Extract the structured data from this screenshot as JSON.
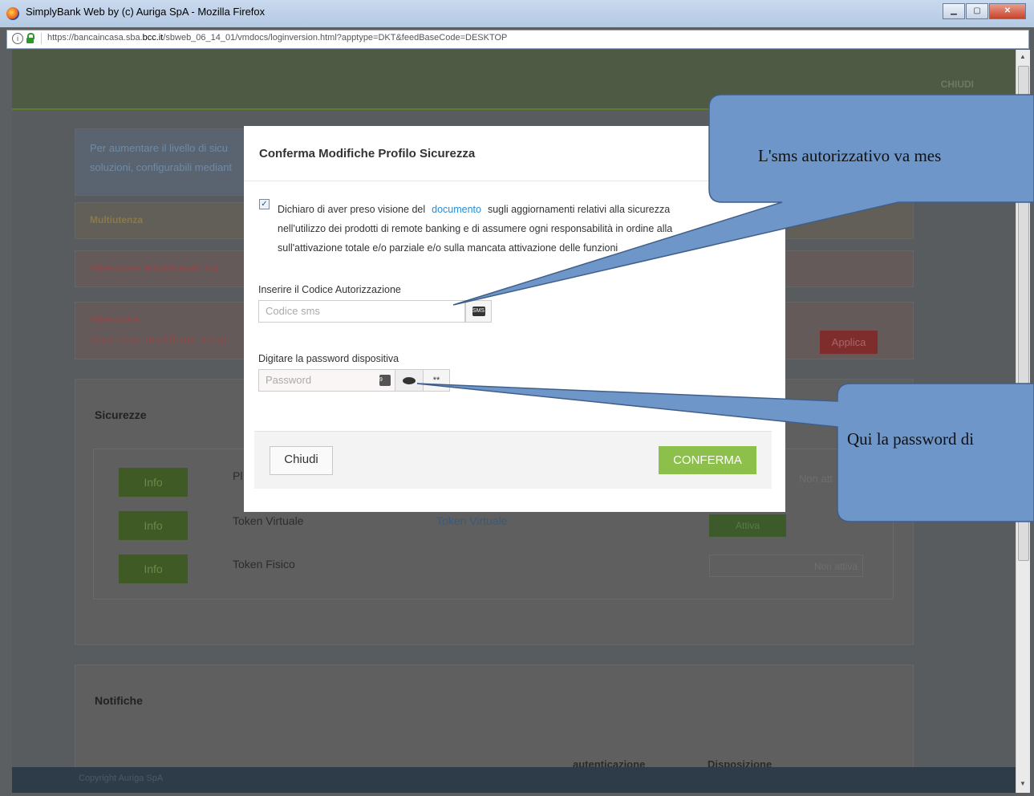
{
  "window": {
    "title": "SimplyBank Web by (c) Auriga SpA - Mozilla Firefox",
    "url_prefix": "https://bancaincasa.sba.",
    "url_domain": "bcc.it",
    "url_path": "/sbweb_06_14_01/vmdocs/loginversion.html?apptype=DKT&feedBaseCode=DESKTOP"
  },
  "topbar": {
    "close_label": "CHIUDI"
  },
  "background": {
    "info_line1": "Per aumentare il livello di sicu",
    "info_line2": "soluzioni, configurabili mediant",
    "multiutenza": "Multiutenza",
    "warning": "Attenzione! Modificando il p",
    "attenzione_title": "Attenzione",
    "attenzione_body": "Dopo aver modificato un'op",
    "applica": "Applica",
    "sicurezze_title": "Sicurezze",
    "rows": [
      {
        "info": "Info",
        "name": "Pl",
        "link": "",
        "status_on": "",
        "status_off": "Non att"
      },
      {
        "info": "Info",
        "name": "Token Virtuale",
        "link": "Token Virtuale",
        "status_on": "Attiva",
        "status_off": ""
      },
      {
        "info": "Info",
        "name": "Token Fisico",
        "link": "",
        "status_on": "",
        "status_off": "Non attiva"
      }
    ],
    "notifiche_title": "Notifiche",
    "col_autenticazione": "autenticazione",
    "col_disposizione": "Disposizione",
    "copyright": "Copyright Auriga SpA"
  },
  "modal": {
    "title": "Conferma Modifiche Profilo Sicurezza",
    "checkbox_checked": true,
    "decl_part1": "Dichiaro di aver preso visione del",
    "decl_link": "documento",
    "decl_part2": "sugli aggiornamenti relativi alla sicurezza",
    "decl_line2": "nell'utilizzo dei prodotti di remote banking e di assumere ogni responsabilità in ordine alla",
    "decl_line3": "sull'attivazione totale e/o parziale e/o sulla mancata attivazione delle funzioni",
    "auth_label": "Inserire il Codice Autorizzazione",
    "auth_placeholder": "Codice sms",
    "sms_icon_text": "SMS",
    "pw_label": "Digitare la password dispositiva",
    "pw_placeholder": "Password",
    "pw_stars": "**",
    "close_button": "Chiudi",
    "confirm_button": "CONFERMA"
  },
  "callouts": {
    "top": "L'sms autorizzativo va mes",
    "bottom": "Qui la password di"
  },
  "colors": {
    "confirm": "#8cc04a",
    "link": "#2a8ccf",
    "callout": "#6f96c9"
  }
}
